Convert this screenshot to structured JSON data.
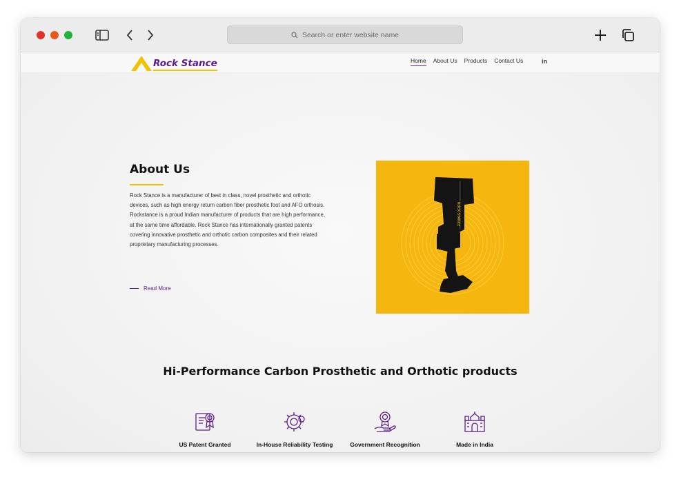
{
  "browser": {
    "url_placeholder": "Search or enter website name"
  },
  "site": {
    "logo_text": "Rock Stance",
    "nav": {
      "items": [
        "Home",
        "About Us",
        "Products",
        "Contact Us"
      ],
      "active": "Home",
      "linkedin_label": "in"
    }
  },
  "about": {
    "title": "About Us",
    "body": "Rock Stance is a manufacturer of best in class, novel prosthetic and orthotic devices, such as high energy return carbon fiber prosthetic foot and AFO orthosis. Rockstance is a proud Indian manufacturer of products that are high performance, at the same time affordable. Rock Stance has internationally granted patents covering innovative prosthetic and orthotic carbon composites and their related proprietary manufacturing processes.",
    "read_more": "Read More"
  },
  "products": {
    "title": "Hi-Performance Carbon Prosthetic and Orthotic products",
    "features": [
      {
        "label": "US Patent Granted",
        "icon": "patent-certificate-icon"
      },
      {
        "label": "In-House Reliability Testing",
        "icon": "gear-testing-icon"
      },
      {
        "label": "Government Recognition",
        "icon": "award-hand-icon"
      },
      {
        "label": "Made in India",
        "icon": "india-monument-icon"
      }
    ]
  },
  "colors": {
    "brand_purple": "#5b1d8c",
    "brand_yellow": "#f2c200",
    "hero_bg": "#f4b60f"
  }
}
